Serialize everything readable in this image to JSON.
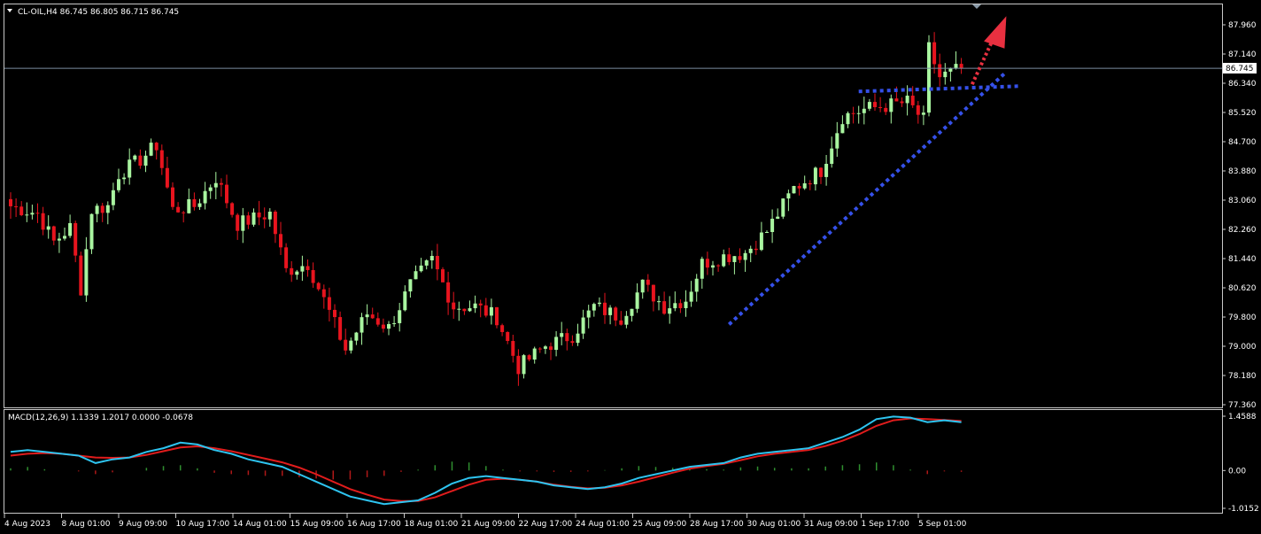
{
  "symbol_header": "CL-OIL,H4  86.745 86.805 86.715 86.745",
  "current_price_label": "86.745",
  "macd_header": "MACD(12,26,9) 1.1339 1.2017 0.0000 -0.0678",
  "colors": {
    "background": "#000000",
    "bull_candle": "#a9f5a0",
    "bear_candle": "#e8141e",
    "macd_main": "#2ec4f0",
    "macd_signal": "#e01c1c",
    "hist_pos": "#2f8f2f",
    "hist_neg": "#b01818",
    "trendline": "#3550e8",
    "price_line": "#7a8ca0",
    "arrow": "#e83040"
  },
  "chart_data": [
    {
      "type": "candlestick",
      "ylim": [
        77.36,
        88.6
      ],
      "y_ticks": [
        "87.960",
        "87.140",
        "86.340",
        "85.520",
        "84.700",
        "83.880",
        "83.060",
        "82.260",
        "81.440",
        "80.620",
        "79.800",
        "79.000",
        "78.180",
        "77.360"
      ],
      "x_ticks": [
        "4 Aug 2023",
        "8 Aug 01:00",
        "9 Aug 09:00",
        "10 Aug 17:00",
        "14 Aug 01:00",
        "15 Aug 09:00",
        "16 Aug 17:00",
        "18 Aug 01:00",
        "21 Aug 09:00",
        "22 Aug 17:00",
        "24 Aug 01:00",
        "25 Aug 09:00",
        "28 Aug 17:00",
        "30 Aug 01:00",
        "31 Aug 09:00",
        "1 Sep 17:00",
        "5 Sep 01:00"
      ],
      "anchors": [
        {
          "i": 0,
          "p": 82.9
        },
        {
          "i": 5,
          "p": 82.7
        },
        {
          "i": 8,
          "p": 81.9
        },
        {
          "i": 11,
          "p": 82.3
        },
        {
          "i": 13,
          "p": 80.6
        },
        {
          "i": 15,
          "p": 82.8
        },
        {
          "i": 18,
          "p": 82.9
        },
        {
          "i": 20,
          "p": 83.8
        },
        {
          "i": 24,
          "p": 84.2
        },
        {
          "i": 27,
          "p": 84.6
        },
        {
          "i": 30,
          "p": 82.8
        },
        {
          "i": 34,
          "p": 82.9
        },
        {
          "i": 38,
          "p": 83.7
        },
        {
          "i": 42,
          "p": 82.4
        },
        {
          "i": 48,
          "p": 82.7
        },
        {
          "i": 51,
          "p": 81.1
        },
        {
          "i": 55,
          "p": 81.3
        },
        {
          "i": 60,
          "p": 79.6
        },
        {
          "i": 62,
          "p": 78.9
        },
        {
          "i": 66,
          "p": 79.9
        },
        {
          "i": 70,
          "p": 79.5
        },
        {
          "i": 74,
          "p": 80.7
        },
        {
          "i": 78,
          "p": 81.4
        },
        {
          "i": 82,
          "p": 80.1
        },
        {
          "i": 86,
          "p": 80.1
        },
        {
          "i": 90,
          "p": 79.8
        },
        {
          "i": 94,
          "p": 78.4
        },
        {
          "i": 99,
          "p": 79.0
        },
        {
          "i": 104,
          "p": 79.3
        },
        {
          "i": 108,
          "p": 80.1
        },
        {
          "i": 113,
          "p": 79.8
        },
        {
          "i": 117,
          "p": 80.7
        },
        {
          "i": 121,
          "p": 80.1
        },
        {
          "i": 125,
          "p": 80.3
        },
        {
          "i": 128,
          "p": 81.3
        },
        {
          "i": 132,
          "p": 81.5
        },
        {
          "i": 136,
          "p": 81.6
        },
        {
          "i": 140,
          "p": 82.2
        },
        {
          "i": 145,
          "p": 83.4
        },
        {
          "i": 150,
          "p": 83.9
        },
        {
          "i": 154,
          "p": 85.4
        },
        {
          "i": 158,
          "p": 85.6
        },
        {
          "i": 162,
          "p": 85.7
        },
        {
          "i": 166,
          "p": 85.8
        },
        {
          "i": 169,
          "p": 85.3
        },
        {
          "i": 170,
          "p": 87.3
        },
        {
          "i": 172,
          "p": 86.5
        },
        {
          "i": 176,
          "p": 86.745
        }
      ],
      "y_range_macd": [
        -1.0152,
        1.4588
      ],
      "macd_ticks": [
        "1.4588",
        "0.00",
        "-1.0152"
      ],
      "macd_main": [
        0.5,
        0.55,
        0.5,
        0.45,
        0.4,
        0.2,
        0.3,
        0.35,
        0.5,
        0.6,
        0.75,
        0.7,
        0.55,
        0.45,
        0.3,
        0.2,
        0.1,
        -0.1,
        -0.3,
        -0.5,
        -0.7,
        -0.8,
        -0.9,
        -0.85,
        -0.8,
        -0.6,
        -0.35,
        -0.2,
        -0.15,
        -0.2,
        -0.25,
        -0.3,
        -0.4,
        -0.45,
        -0.5,
        -0.45,
        -0.35,
        -0.2,
        -0.1,
        0.0,
        0.1,
        0.15,
        0.2,
        0.35,
        0.45,
        0.5,
        0.55,
        0.6,
        0.75,
        0.9,
        1.1,
        1.38,
        1.45,
        1.42,
        1.3,
        1.35,
        1.3
      ],
      "macd_signal": [
        0.4,
        0.45,
        0.47,
        0.45,
        0.4,
        0.35,
        0.34,
        0.35,
        0.42,
        0.52,
        0.62,
        0.65,
        0.6,
        0.52,
        0.42,
        0.32,
        0.22,
        0.08,
        -0.1,
        -0.3,
        -0.5,
        -0.65,
        -0.78,
        -0.82,
        -0.82,
        -0.72,
        -0.55,
        -0.38,
        -0.25,
        -0.22,
        -0.25,
        -0.3,
        -0.38,
        -0.44,
        -0.48,
        -0.46,
        -0.4,
        -0.3,
        -0.18,
        -0.06,
        0.05,
        0.12,
        0.18,
        0.28,
        0.38,
        0.45,
        0.5,
        0.55,
        0.66,
        0.8,
        0.98,
        1.2,
        1.35,
        1.4,
        1.38,
        1.36,
        1.33
      ],
      "macd_hist": [
        0.05,
        0.08,
        0.03,
        0.0,
        -0.02,
        -0.08,
        -0.04,
        0.0,
        0.06,
        0.1,
        0.12,
        0.05,
        -0.05,
        -0.08,
        -0.1,
        -0.12,
        -0.12,
        -0.15,
        -0.18,
        -0.2,
        -0.2,
        -0.15,
        -0.12,
        -0.03,
        0.02,
        0.12,
        0.2,
        0.18,
        0.1,
        0.02,
        -0.02,
        -0.02,
        -0.03,
        -0.03,
        -0.02,
        0.01,
        0.05,
        0.1,
        0.08,
        0.06,
        0.05,
        0.03,
        0.02,
        0.07,
        0.09,
        0.06,
        0.05,
        0.05,
        0.09,
        0.12,
        0.14,
        0.18,
        0.12,
        0.02,
        -0.08,
        -0.02,
        -0.03
      ]
    }
  ]
}
